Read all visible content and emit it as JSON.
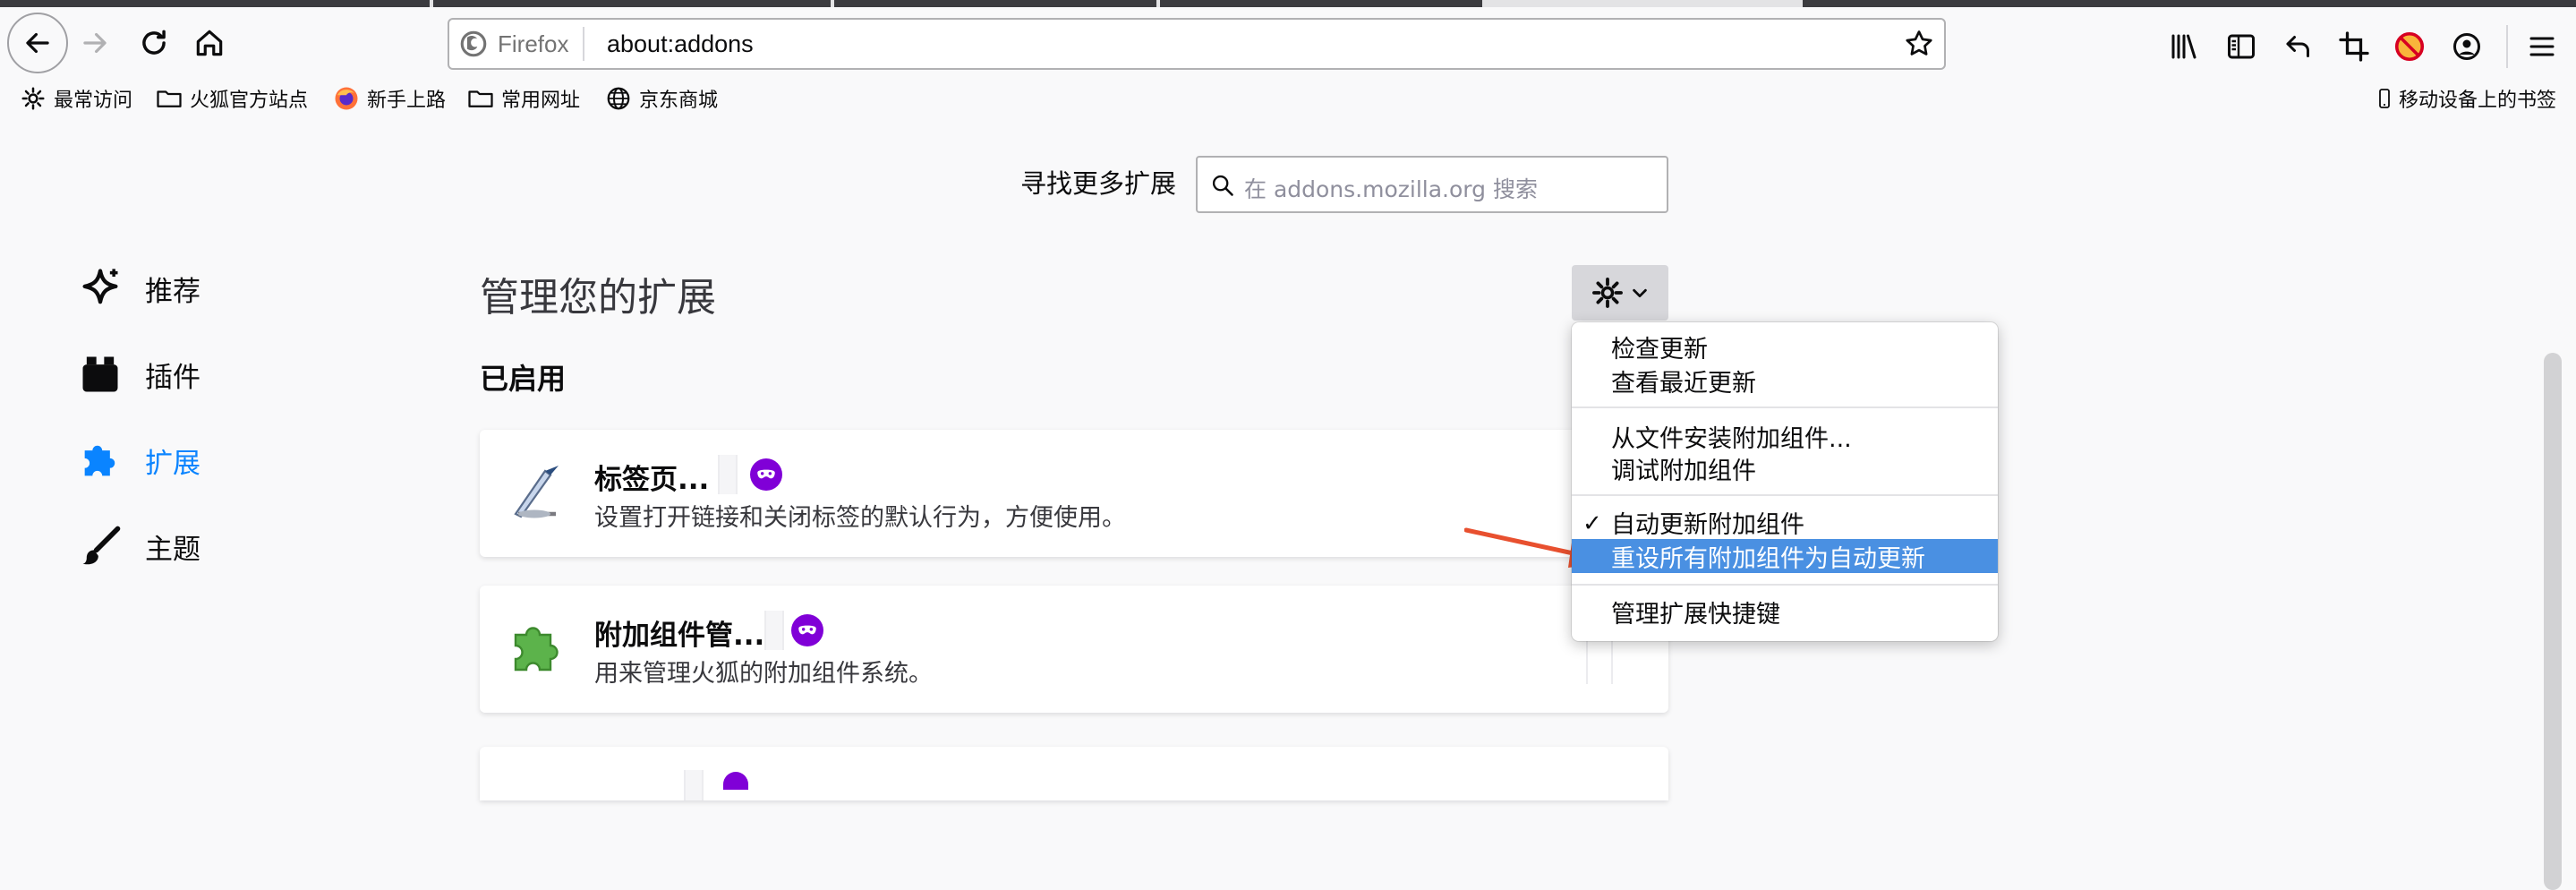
{
  "toolbar": {
    "identity_label": "Firefox",
    "url": "about:addons"
  },
  "bookmarks": {
    "left": [
      {
        "label": "最常访问",
        "icon": "gear-icon"
      },
      {
        "label": "火狐官方站点",
        "icon": "folder-icon"
      },
      {
        "label": "新手上路",
        "icon": "firefox-icon"
      },
      {
        "label": "常用网址",
        "icon": "folder-icon"
      },
      {
        "label": "京东商城",
        "icon": "globe-icon"
      }
    ],
    "mobile": "移动设备上的书签"
  },
  "find": {
    "label": "寻找更多扩展",
    "placeholder": "在 addons.mozilla.org 搜索"
  },
  "categories": [
    {
      "label": "推荐",
      "icon": "sparkle-icon"
    },
    {
      "label": "插件",
      "icon": "plugin-icon"
    },
    {
      "label": "扩展",
      "icon": "puzzle-icon",
      "selected": true
    },
    {
      "label": "主题",
      "icon": "brush-icon"
    }
  ],
  "main": {
    "heading": "管理您的扩展",
    "section_enabled": "已启用"
  },
  "extensions": [
    {
      "name": "标签页...",
      "description": "设置打开链接和关闭标签的默认行为，方便使用。",
      "icon": "tab-quill-icon"
    },
    {
      "name": "附加组件管...",
      "description": "用来管理火狐的附加组件系统。",
      "icon": "green-puzzle-icon"
    }
  ],
  "menu": {
    "items": [
      {
        "label": "检查更新"
      },
      {
        "label": "查看最近更新"
      },
      {
        "label": "从文件安装附加组件..."
      },
      {
        "label": "调试附加组件"
      },
      {
        "label": "自动更新附加组件",
        "checked": true
      },
      {
        "label": "重设所有附加组件为自动更新",
        "highlighted": true
      },
      {
        "label": "管理扩展快捷键"
      }
    ],
    "check_mark": "✓"
  },
  "colors": {
    "accent": "#0a84ff",
    "menu_highlight": "#4a90e2",
    "private_badge": "#8000d7",
    "arrow": "#e8502f"
  }
}
